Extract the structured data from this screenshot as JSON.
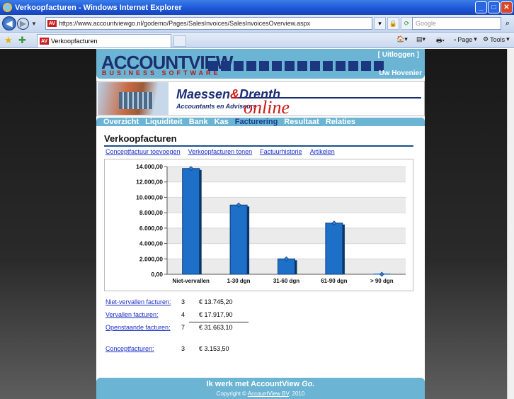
{
  "window": {
    "title": "Verkoopfacturen - Windows Internet Explorer"
  },
  "browser": {
    "url": "https://www.accountviewgo.nl/godemo/Pages/SalesInvoices/SalesInvoicesOverview.aspx",
    "search_placeholder": "Google",
    "tab_title": "Verkoopfacturen",
    "favicon_text": "AV",
    "page_menu": "Page",
    "tools_menu": "Tools"
  },
  "header": {
    "logo_main": "ACCOUNTVIEW",
    "logo_sub": "BUSINESS SOFTWARE",
    "logout": "[ Uitloggen ]",
    "user": "Uw Hovenier"
  },
  "banner": {
    "name_part1": "Maessen",
    "name_amp": "&",
    "name_part2": "Drenth",
    "subtitle": "Accountants en Adviseurs",
    "online": "online"
  },
  "nav": {
    "items": [
      "Overzicht",
      "Liquiditeit",
      "Bank",
      "Kas",
      "Facturering",
      "Resultaat",
      "Relaties"
    ],
    "active": "Facturering"
  },
  "page": {
    "title": "Verkoopfacturen",
    "links": [
      "Conceptfactuur toevoegen",
      "Verkoopfacturen tonen",
      "Factuurhistorie",
      "Artikelen"
    ]
  },
  "chart_data": {
    "type": "bar",
    "categories": [
      "Niet-vervallen",
      "1-30 dgn",
      "31-60 dgn",
      "61-90 dgn",
      "> 90 dgn"
    ],
    "values": [
      13745.2,
      9000,
      2000,
      6650,
      0
    ],
    "ylim": [
      0,
      14000
    ],
    "yticks": [
      "0,00",
      "2.000,00",
      "4.000,00",
      "6.000,00",
      "8.000,00",
      "10.000,00",
      "12.000,00",
      "14.000,00"
    ],
    "bar_color": "#1d6fc8",
    "grid": true
  },
  "stats": {
    "niet_vervallen": {
      "label": "Niet-vervallen facturen:",
      "count": "3",
      "amount": "€ 13.745,20"
    },
    "vervallen": {
      "label": "Vervallen facturen:",
      "count": "4",
      "amount": "€ 17.917,90"
    },
    "openstaande": {
      "label": "Openstaande facturen:",
      "count": "7",
      "amount": "€ 31.663,10"
    },
    "concept": {
      "label": "Conceptfacturen:",
      "count": "3",
      "amount": "€ 3.153,50"
    }
  },
  "footer": {
    "text_prefix": "Ik werk met AccountView",
    "text_go": "Go.",
    "copyright_prefix": "Copyright ©",
    "copyright_link": "AccountView BV",
    "copyright_year": ", 2010"
  }
}
